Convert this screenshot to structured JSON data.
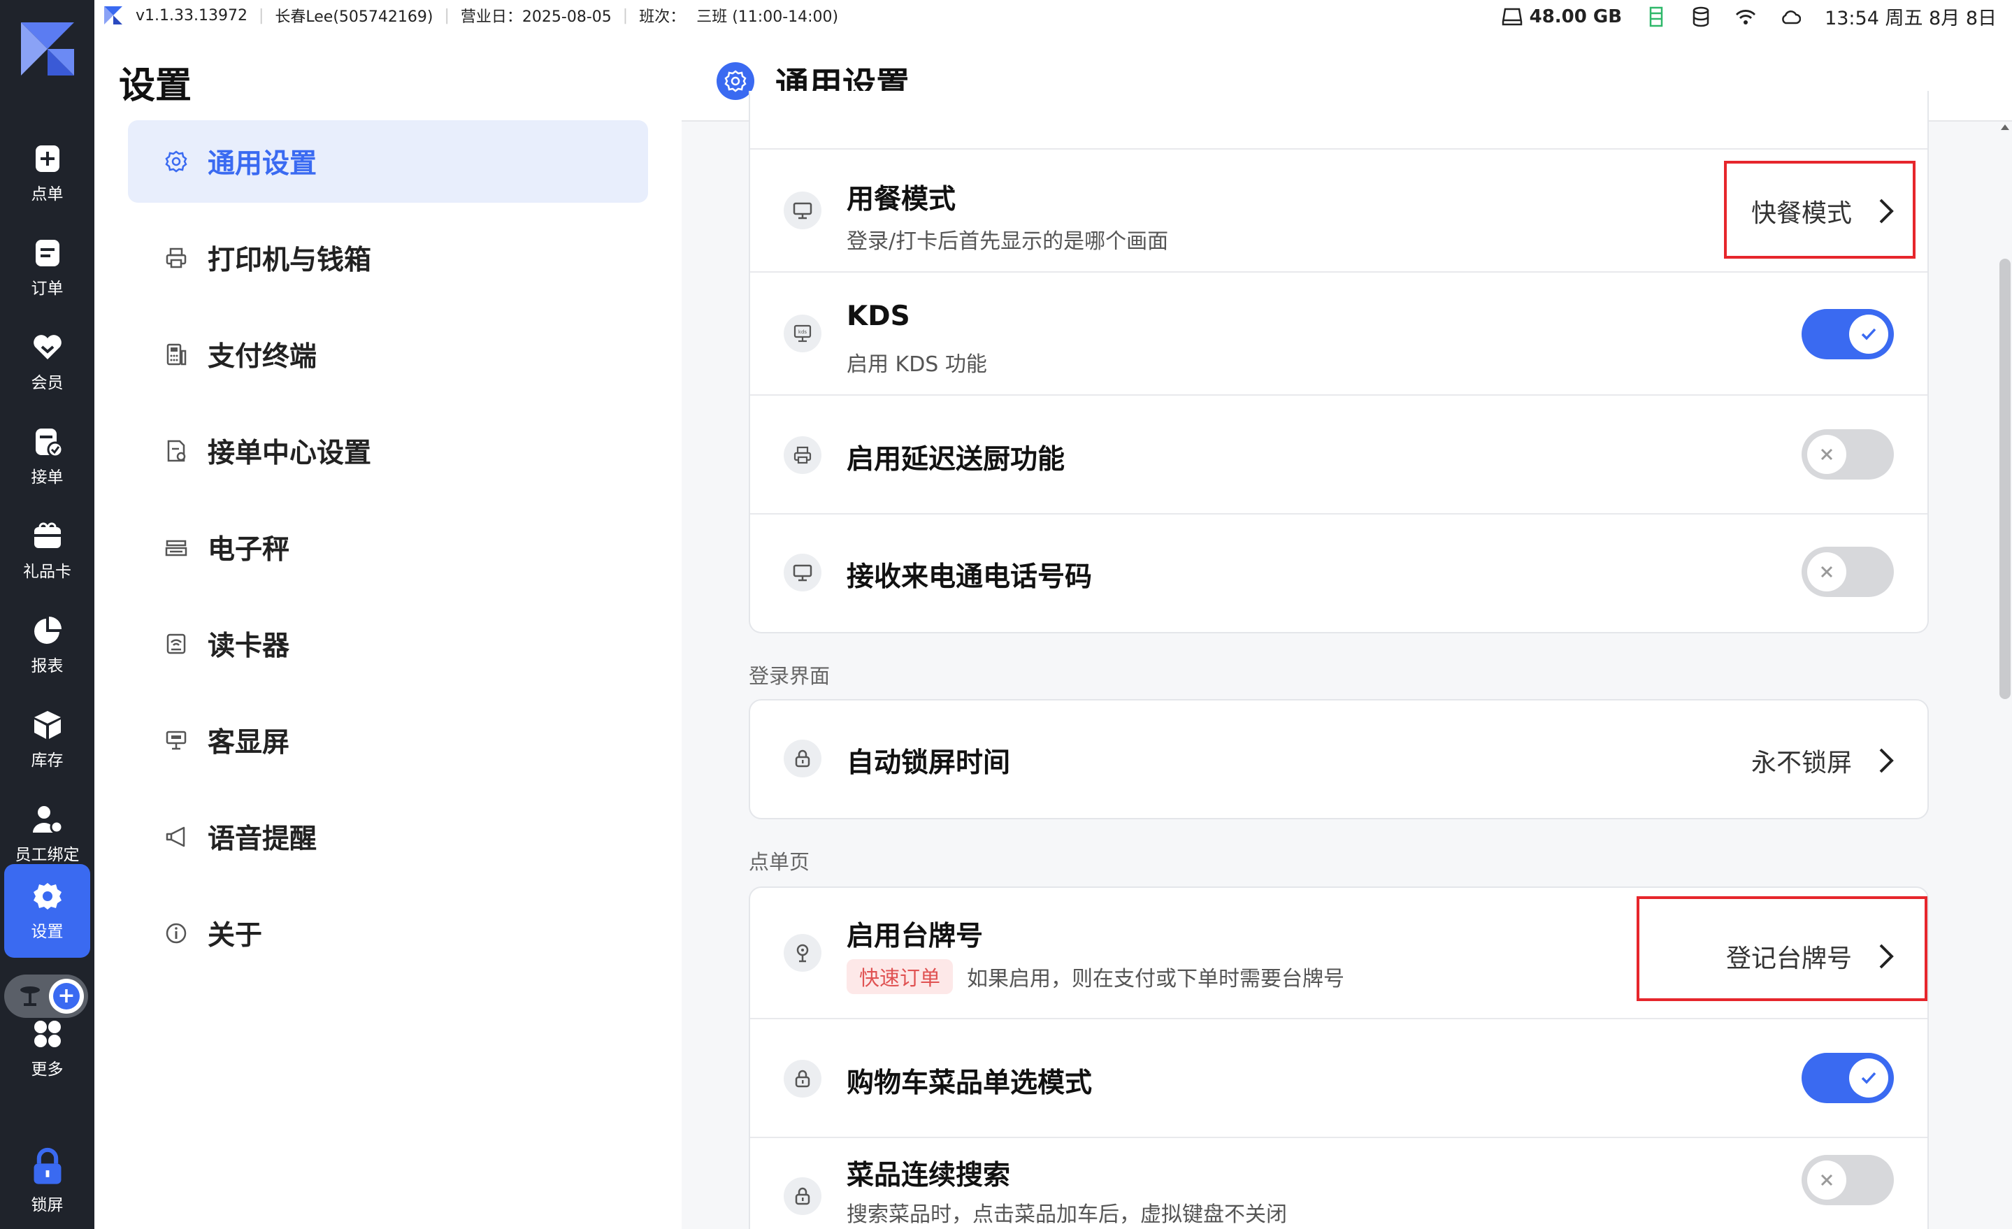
{
  "statusbar": {
    "version": "v1.1.33.13972",
    "user": "长春Lee(505742169)",
    "business_day": "营业日：2025-08-05",
    "shift_label": "班次：",
    "shift_value": "三班 (11:00-14:00)",
    "storage": "48.00 GB",
    "clock": "13:54 周五 8月 8日"
  },
  "rail": {
    "items": [
      {
        "label": "点单",
        "icon": "add-order-icon"
      },
      {
        "label": "订单",
        "icon": "order-list-icon"
      },
      {
        "label": "会员",
        "icon": "member-heart-icon"
      },
      {
        "label": "接单",
        "icon": "receive-order-icon"
      },
      {
        "label": "礼品卡",
        "icon": "gift-card-icon"
      },
      {
        "label": "报表",
        "icon": "pie-chart-icon"
      },
      {
        "label": "库存",
        "icon": "inventory-box-icon"
      },
      {
        "label": "员工绑定",
        "icon": "staff-bind-icon"
      },
      {
        "label": "设置",
        "icon": "gear-icon"
      },
      {
        "label": "更多",
        "icon": "more-grid-icon"
      },
      {
        "label": "锁屏",
        "icon": "lock-icon"
      }
    ],
    "active": "设置"
  },
  "settings_nav": {
    "title": "设置",
    "items": [
      {
        "label": "通用设置",
        "icon": "gear-icon"
      },
      {
        "label": "打印机与钱箱",
        "icon": "printer-icon"
      },
      {
        "label": "支付终端",
        "icon": "pos-terminal-icon"
      },
      {
        "label": "接单中心设置",
        "icon": "order-center-icon"
      },
      {
        "label": "电子秤",
        "icon": "scale-icon"
      },
      {
        "label": "读卡器",
        "icon": "card-reader-icon"
      },
      {
        "label": "客显屏",
        "icon": "customer-display-icon"
      },
      {
        "label": "语音提醒",
        "icon": "megaphone-icon"
      },
      {
        "label": "关于",
        "icon": "info-icon"
      }
    ],
    "active": "通用设置"
  },
  "panel": {
    "title": "通用设置",
    "card1": [
      {
        "title": "用餐模式",
        "subtitle": "登录/打卡后首先显示的是哪个画面",
        "value": "快餐模式",
        "icon": "monitor-icon"
      },
      {
        "title": "KDS",
        "subtitle": "启用 KDS 功能",
        "toggle": true,
        "icon": "kds-icon"
      },
      {
        "title": "启用延迟送厨功能",
        "toggle": false,
        "icon": "printer-icon"
      },
      {
        "title": "接收来电通电话号码",
        "toggle": false,
        "icon": "monitor-icon"
      }
    ],
    "section_login": "登录界面",
    "card2": [
      {
        "title": "自动锁屏时间",
        "value": "永不锁屏",
        "icon": "lock-icon"
      }
    ],
    "section_order": "点单页",
    "card3": [
      {
        "title": "启用台牌号",
        "tag": "快速订单",
        "subtitle": "如果启用，则在支付或下单时需要台牌号",
        "value": "登记台牌号",
        "icon": "table-sign-icon"
      },
      {
        "title": "购物车菜品单选模式",
        "toggle": true,
        "icon": "lock-icon"
      },
      {
        "title": "菜品连续搜索",
        "subtitle": "搜索菜品时，点击菜品加车后，虚拟键盘不关闭",
        "toggle": false,
        "icon": "lock-icon"
      }
    ]
  },
  "colors": {
    "accent": "#3a6af1",
    "rail_bg": "#1f232b",
    "highlight_box": "#e6262c",
    "tag_text": "#e05252"
  }
}
